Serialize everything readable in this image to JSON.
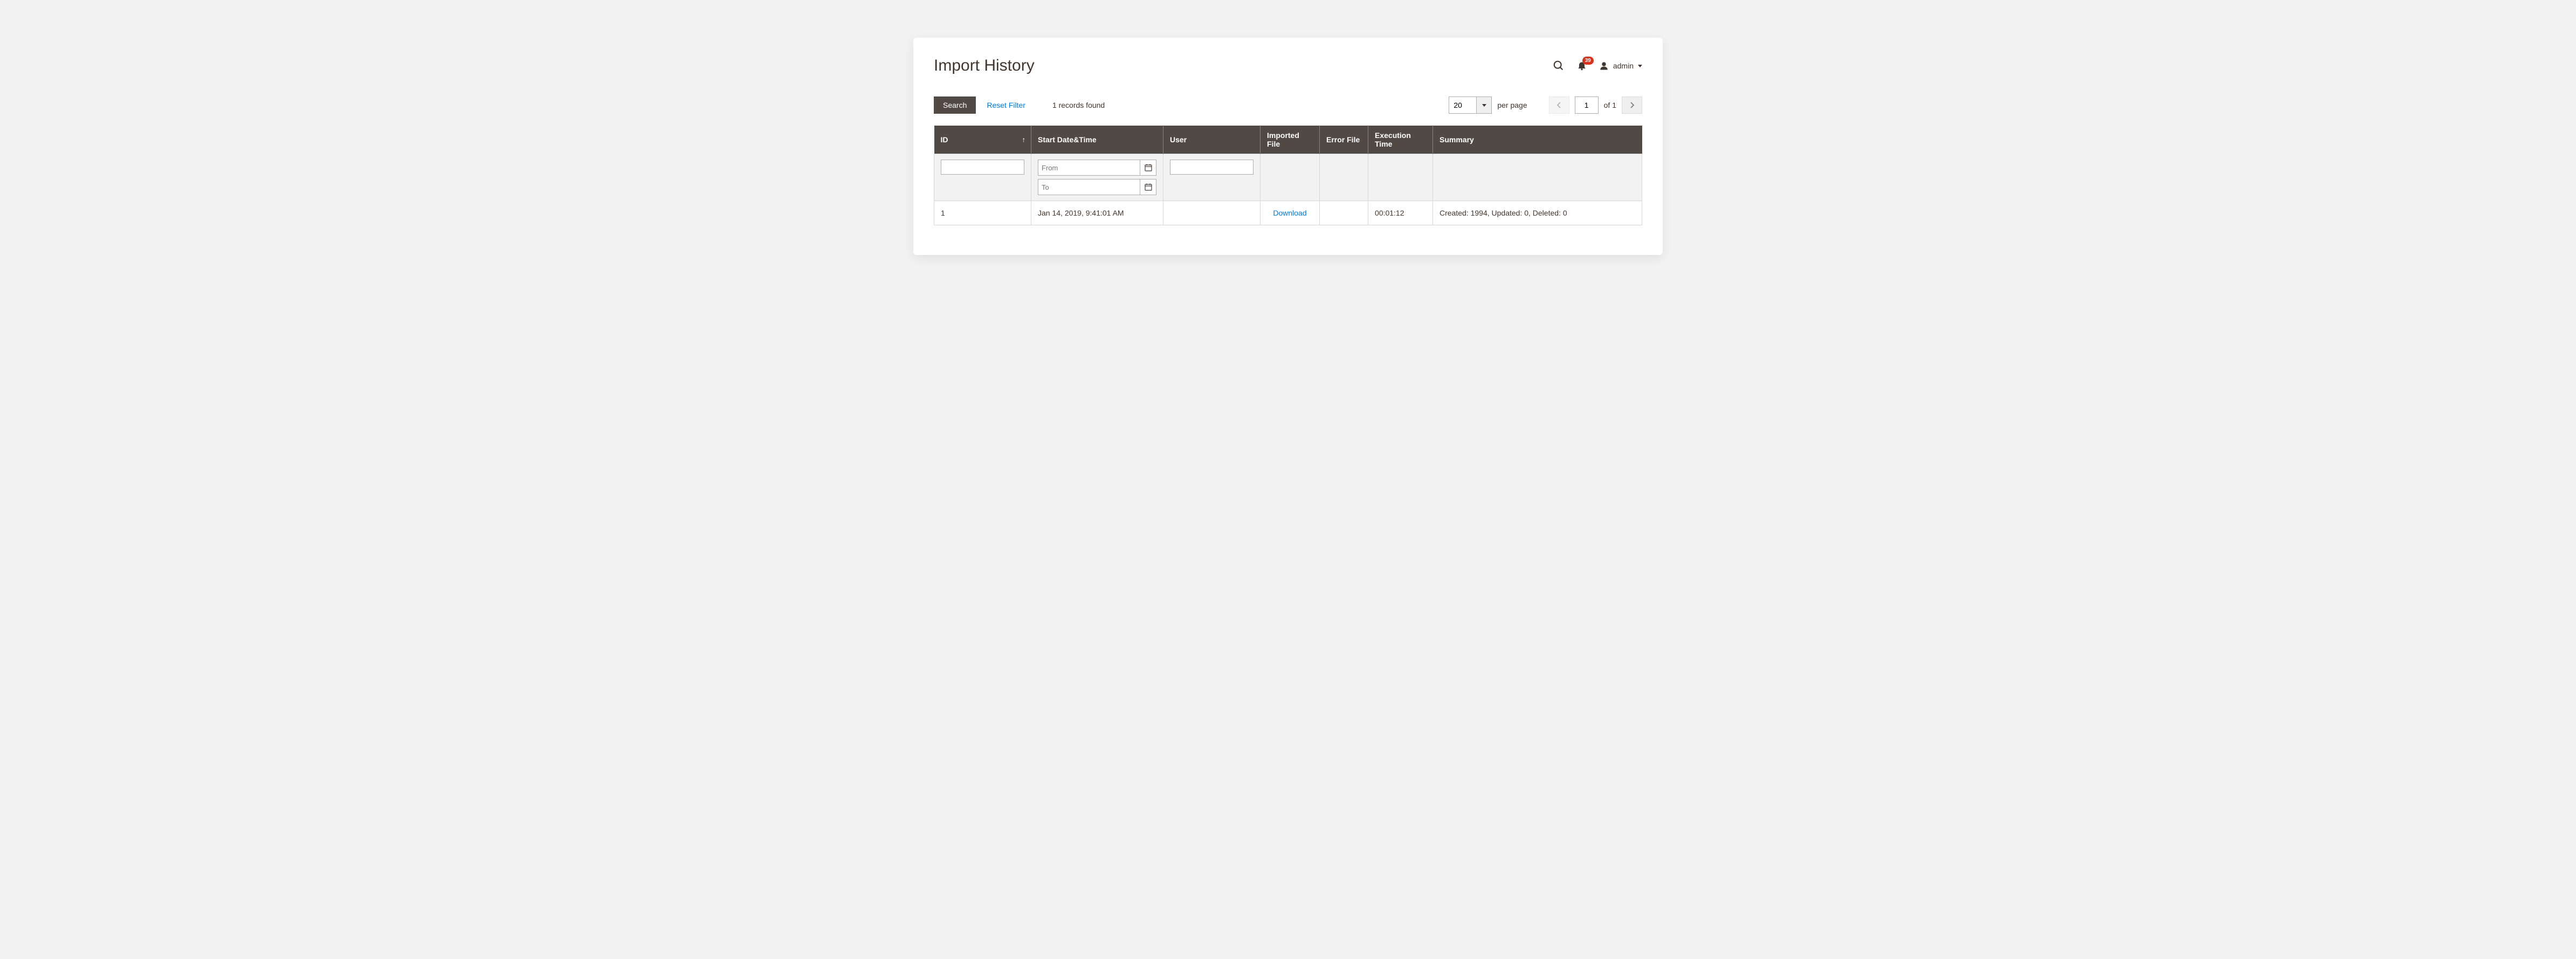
{
  "header": {
    "title": "Import History",
    "notification_count": "39",
    "user_name": "admin"
  },
  "toolbar": {
    "search_label": "Search",
    "reset_label": "Reset Filter",
    "records_found": "1 records found",
    "per_page_value": "20",
    "per_page_label": "per page",
    "current_page": "1",
    "page_of": "of 1"
  },
  "columns": {
    "id": "ID",
    "start": "Start Date&Time",
    "user": "User",
    "imported": "Imported File",
    "error": "Error File",
    "exec": "Execution Time",
    "summary": "Summary"
  },
  "filters": {
    "from_placeholder": "From",
    "to_placeholder": "To"
  },
  "rows": [
    {
      "id": "1",
      "start": "Jan 14, 2019, 9:41:01 AM",
      "user": "",
      "imported": "Download",
      "error": "",
      "exec": "00:01:12",
      "summary": "Created: 1994, Updated: 0, Deleted: 0"
    }
  ]
}
